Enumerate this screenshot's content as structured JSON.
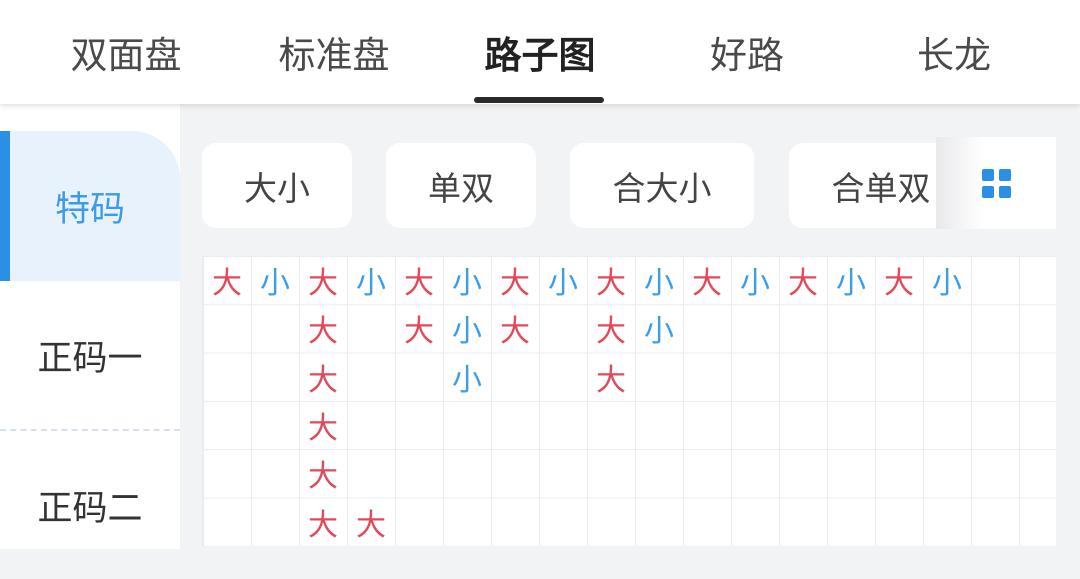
{
  "tabs": [
    {
      "label": "双面盘",
      "active": false
    },
    {
      "label": "标准盘",
      "active": false
    },
    {
      "label": "路子图",
      "active": true
    },
    {
      "label": "好路",
      "active": false
    },
    {
      "label": "长龙",
      "active": false
    }
  ],
  "sidebar": {
    "items": [
      {
        "label": "特码",
        "active": true
      },
      {
        "label": "正码一",
        "active": false
      },
      {
        "label": "正码二",
        "active": false
      }
    ]
  },
  "filters": [
    {
      "label": "大小"
    },
    {
      "label": "单双"
    },
    {
      "label": "合大小"
    },
    {
      "label": "合单双"
    }
  ],
  "grid_button_icon": "grid-icon",
  "colors": {
    "accent": "#2b8fe8",
    "big": "#e14a5a",
    "small": "#3c9ee6"
  },
  "road": {
    "columns": [
      [
        "大"
      ],
      [
        "小"
      ],
      [
        "大",
        "大",
        "大",
        "大",
        "大",
        "大"
      ],
      [
        "小",
        null,
        null,
        null,
        null,
        "大"
      ],
      [
        "大",
        "大"
      ],
      [
        "小",
        "小",
        "小"
      ],
      [
        "大",
        "大"
      ],
      [
        "小"
      ],
      [
        "大",
        "大",
        "大"
      ],
      [
        "小",
        "小"
      ],
      [
        "大"
      ],
      [
        "小"
      ],
      [
        "大"
      ],
      [
        "小"
      ],
      [
        "大"
      ],
      [
        "小"
      ]
    ]
  }
}
